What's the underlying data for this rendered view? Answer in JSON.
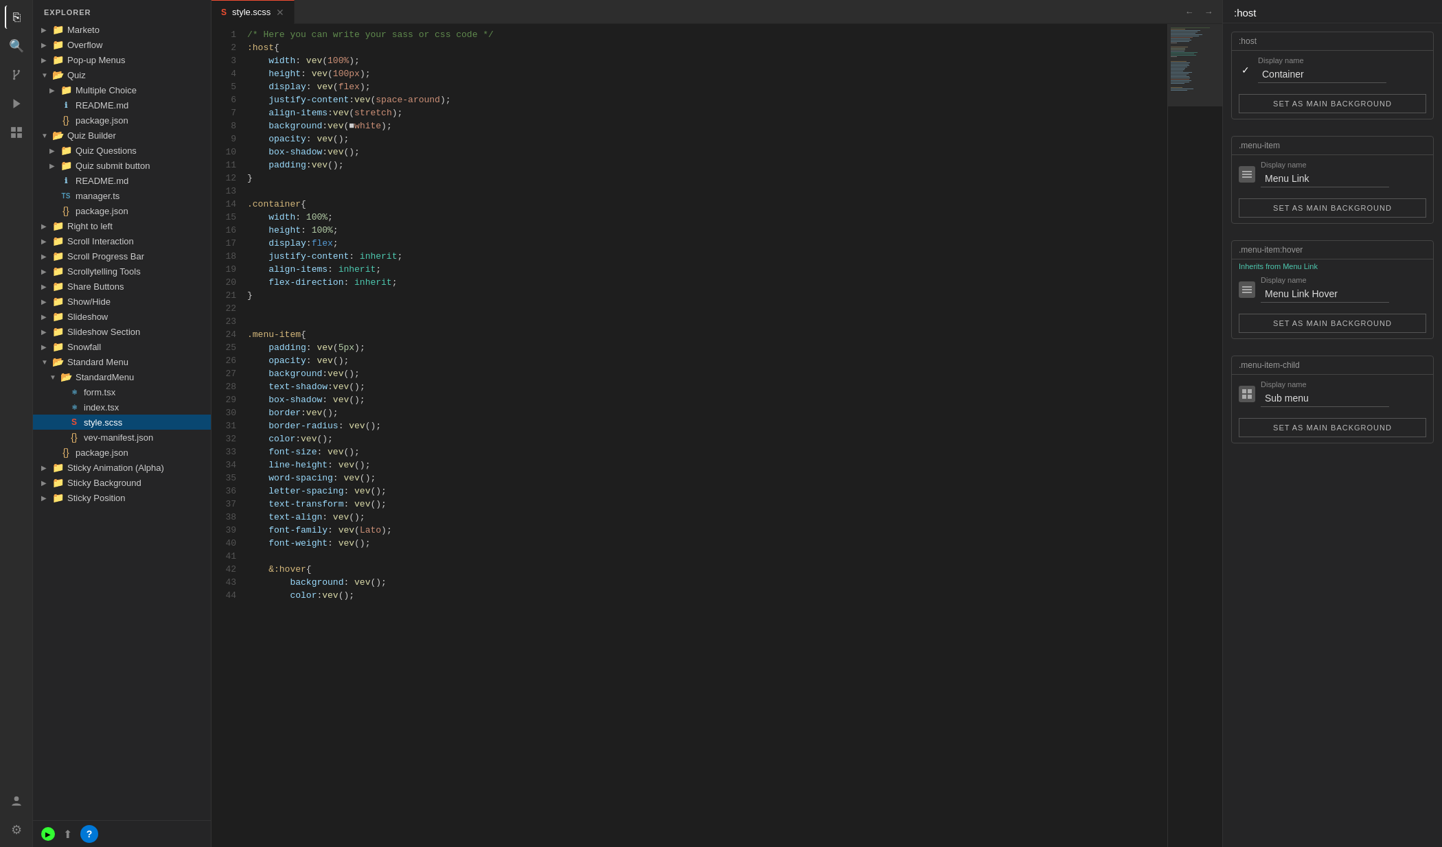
{
  "activityBar": {
    "icons": [
      {
        "name": "files-icon",
        "symbol": "⎘",
        "active": true
      },
      {
        "name": "search-icon",
        "symbol": "🔍"
      },
      {
        "name": "source-control-icon",
        "symbol": "⑂"
      },
      {
        "name": "debug-icon",
        "symbol": "▷"
      },
      {
        "name": "extensions-icon",
        "symbol": "⊞"
      },
      {
        "name": "remote-icon",
        "symbol": "⊙"
      },
      {
        "name": "help-icon",
        "symbol": "?"
      }
    ]
  },
  "sidebar": {
    "title": "EXPLORER",
    "items": [
      {
        "id": "marketo",
        "label": "Marketo",
        "type": "folder",
        "indent": 0,
        "expanded": false
      },
      {
        "id": "overflow",
        "label": "Overflow",
        "type": "folder",
        "indent": 0,
        "expanded": false
      },
      {
        "id": "popup-menus",
        "label": "Pop-up Menus",
        "type": "folder",
        "indent": 0,
        "expanded": false
      },
      {
        "id": "quiz",
        "label": "Quiz",
        "type": "folder",
        "indent": 0,
        "expanded": true
      },
      {
        "id": "multiple-choice",
        "label": "Multiple Choice",
        "type": "folder",
        "indent": 1,
        "expanded": false
      },
      {
        "id": "readme-md-quiz",
        "label": "README.md",
        "type": "md",
        "indent": 1
      },
      {
        "id": "package-json-quiz",
        "label": "package.json",
        "type": "json",
        "indent": 1
      },
      {
        "id": "quiz-builder",
        "label": "Quiz Builder",
        "type": "folder",
        "indent": 0,
        "expanded": true
      },
      {
        "id": "quiz-questions",
        "label": "Quiz Questions",
        "type": "folder",
        "indent": 1
      },
      {
        "id": "quiz-submit-button",
        "label": "Quiz submit button",
        "type": "folder",
        "indent": 1
      },
      {
        "id": "readme-md-qb",
        "label": "README.md",
        "type": "md",
        "indent": 1
      },
      {
        "id": "manager-ts",
        "label": "manager.ts",
        "type": "ts",
        "indent": 1
      },
      {
        "id": "package-json-qb",
        "label": "package.json",
        "type": "json",
        "indent": 1
      },
      {
        "id": "right-to-left",
        "label": "Right to left",
        "type": "folder",
        "indent": 0,
        "expanded": false
      },
      {
        "id": "scroll-interaction",
        "label": "Scroll Interaction",
        "type": "folder",
        "indent": 0,
        "expanded": false
      },
      {
        "id": "scroll-progress-bar",
        "label": "Scroll Progress Bar",
        "type": "folder",
        "indent": 0,
        "expanded": false
      },
      {
        "id": "scrollytelling-tools",
        "label": "Scrollytelling Tools",
        "type": "folder",
        "indent": 0,
        "expanded": false
      },
      {
        "id": "share-buttons",
        "label": "Share Buttons",
        "type": "folder",
        "indent": 0,
        "expanded": false
      },
      {
        "id": "show-hide",
        "label": "Show/Hide",
        "type": "folder",
        "indent": 0,
        "expanded": false
      },
      {
        "id": "slideshow",
        "label": "Slideshow",
        "type": "folder",
        "indent": 0,
        "expanded": false
      },
      {
        "id": "slideshow-section",
        "label": "Slideshow Section",
        "type": "folder",
        "indent": 0,
        "expanded": false
      },
      {
        "id": "snowfall",
        "label": "Snowfall",
        "type": "folder",
        "indent": 0,
        "expanded": false
      },
      {
        "id": "standard-menu",
        "label": "Standard Menu",
        "type": "folder",
        "indent": 0,
        "expanded": true
      },
      {
        "id": "standard-menu-sub",
        "label": "StandardMenu",
        "type": "folder-open",
        "indent": 1,
        "expanded": true
      },
      {
        "id": "form-tsx",
        "label": "form.tsx",
        "type": "tsx",
        "indent": 2,
        "active": false
      },
      {
        "id": "index-tsx",
        "label": "index.tsx",
        "type": "tsx",
        "indent": 2
      },
      {
        "id": "style-scss",
        "label": "style.scss",
        "type": "scss",
        "indent": 2,
        "active": true
      },
      {
        "id": "vev-manifest-json",
        "label": "vev-manifest.json",
        "type": "json",
        "indent": 2
      },
      {
        "id": "package-json-sm",
        "label": "package.json",
        "type": "json",
        "indent": 1
      },
      {
        "id": "sticky-animation",
        "label": "Sticky Animation (Alpha)",
        "type": "folder",
        "indent": 0
      },
      {
        "id": "sticky-background",
        "label": "Sticky Background",
        "type": "folder",
        "indent": 0
      },
      {
        "id": "sticky-position",
        "label": "Sticky Position",
        "type": "folder",
        "indent": 0
      }
    ]
  },
  "tabs": [
    {
      "id": "style-scss-tab",
      "label": "style.scss",
      "type": "scss",
      "active": true,
      "closeable": true
    }
  ],
  "editor": {
    "lines": [
      {
        "num": 1,
        "content": "comment",
        "text": "/* Here you can write your sass or css code */"
      },
      {
        "num": 2,
        "content": "selector",
        "text": ":host{"
      },
      {
        "num": 3,
        "content": "code",
        "text": "    width: vev(100%);"
      },
      {
        "num": 4,
        "content": "code",
        "text": "    height: vev(100px);"
      },
      {
        "num": 5,
        "content": "code",
        "text": "    display: vev(flex);"
      },
      {
        "num": 6,
        "content": "code",
        "text": "    justify-content:vev(space-around);"
      },
      {
        "num": 7,
        "content": "code",
        "text": "    align-items:vev(stretch);"
      },
      {
        "num": 8,
        "content": "code-swatch",
        "text": "    background:vev(■white);"
      },
      {
        "num": 9,
        "content": "code",
        "text": "    opacity: vev();"
      },
      {
        "num": 10,
        "content": "code",
        "text": "    box-shadow:vev();"
      },
      {
        "num": 11,
        "content": "code",
        "text": "    padding:vev();"
      },
      {
        "num": 12,
        "content": "brace",
        "text": "}"
      },
      {
        "num": 13,
        "content": "empty",
        "text": ""
      },
      {
        "num": 14,
        "content": "selector",
        "text": ".container{"
      },
      {
        "num": 15,
        "content": "code",
        "text": "    width: 100%;"
      },
      {
        "num": 16,
        "content": "code",
        "text": "    height: 100%;"
      },
      {
        "num": 17,
        "content": "code",
        "text": "    display:flex;"
      },
      {
        "num": 18,
        "content": "code",
        "text": "    justify-content: inherit;"
      },
      {
        "num": 19,
        "content": "code",
        "text": "    align-items: inherit;"
      },
      {
        "num": 20,
        "content": "code",
        "text": "    flex-direction: inherit;"
      },
      {
        "num": 21,
        "content": "brace",
        "text": "}"
      },
      {
        "num": 22,
        "content": "empty",
        "text": ""
      },
      {
        "num": 23,
        "content": "empty",
        "text": ""
      },
      {
        "num": 24,
        "content": "selector",
        "text": ".menu-item{"
      },
      {
        "num": 25,
        "content": "code",
        "text": "    padding: vev(5px);"
      },
      {
        "num": 26,
        "content": "code",
        "text": "    opacity: vev();"
      },
      {
        "num": 27,
        "content": "code",
        "text": "    background:vev();"
      },
      {
        "num": 28,
        "content": "code",
        "text": "    text-shadow:vev();"
      },
      {
        "num": 29,
        "content": "code",
        "text": "    box-shadow: vev();"
      },
      {
        "num": 30,
        "content": "code",
        "text": "    border:vev();"
      },
      {
        "num": 31,
        "content": "code",
        "text": "    border-radius: vev();"
      },
      {
        "num": 32,
        "content": "code",
        "text": "    color:vev();"
      },
      {
        "num": 33,
        "content": "code",
        "text": "    font-size: vev();"
      },
      {
        "num": 34,
        "content": "code",
        "text": "    line-height: vev();"
      },
      {
        "num": 35,
        "content": "code",
        "text": "    word-spacing: vev();"
      },
      {
        "num": 36,
        "content": "code",
        "text": "    letter-spacing: vev();"
      },
      {
        "num": 37,
        "content": "code",
        "text": "    text-transform: vev();"
      },
      {
        "num": 38,
        "content": "code",
        "text": "    text-align: vev();"
      },
      {
        "num": 39,
        "content": "code",
        "text": "    font-family: vev(Lato);"
      },
      {
        "num": 40,
        "content": "code",
        "text": "    font-weight: vev();"
      },
      {
        "num": 41,
        "content": "empty",
        "text": ""
      },
      {
        "num": 42,
        "content": "selector",
        "text": "&:hover{"
      },
      {
        "num": 43,
        "content": "code",
        "text": "    background: vev();"
      },
      {
        "num": 44,
        "content": "code",
        "text": "    color:vev();"
      }
    ]
  },
  "rightPanel": {
    "selectorTitle": ":host",
    "cards": [
      {
        "id": "host-card",
        "selector": ":host",
        "hasCheck": true,
        "displayNameLabel": "Display name",
        "displayNameValue": "Container",
        "iconType": "none",
        "setBgLabel": "SET AS MAIN BACKGROUND"
      },
      {
        "id": "menu-item-card",
        "selector": ".menu-item",
        "hasCheck": false,
        "displayNameLabel": "Display name",
        "displayNameValue": "Menu Link",
        "iconType": "rect",
        "setBgLabel": "SET AS MAIN BACKGROUND"
      },
      {
        "id": "menu-item-hover-card",
        "selector": ".menu-item:hover",
        "hasCheck": false,
        "inheritsFrom": "Inherits from Menu Link",
        "displayNameLabel": "Display name",
        "displayNameValue": "Menu Link Hover",
        "iconType": "rect",
        "setBgLabel": "SET AS MAIN BACKGROUND"
      },
      {
        "id": "menu-item-child-card",
        "selector": ".menu-item-child",
        "hasCheck": false,
        "displayNameLabel": "Display name",
        "displayNameValue": "Sub menu",
        "iconType": "grid",
        "setBgLabel": "SET AS MAIN BACKGROUND"
      }
    ]
  }
}
